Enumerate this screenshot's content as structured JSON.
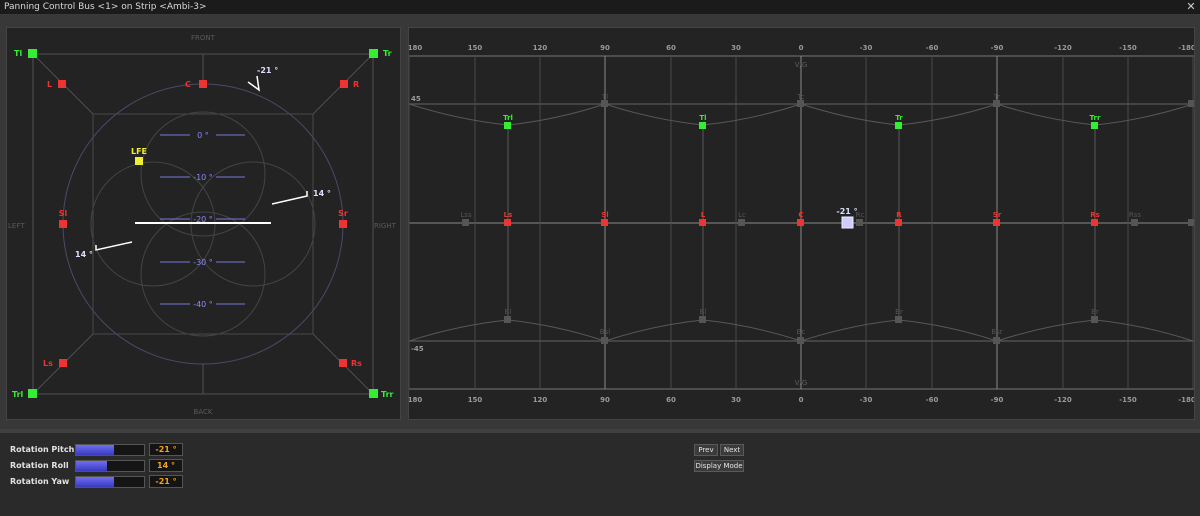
{
  "window": {
    "title": "Panning Control Bus <1> on Strip <Ambi-3>",
    "close_symbol": "✕"
  },
  "colors": {
    "green": "#33ee33",
    "red": "#ee3333",
    "yellow": "#eeee33",
    "blue_label": "#8888ff",
    "rotation_handle": "#ccccff"
  },
  "left_view": {
    "labels": {
      "front": "FRONT",
      "back": "BACK",
      "left": "LEFT",
      "right": "RIGHT"
    },
    "speakers": [
      {
        "name": "Tl",
        "color": "green"
      },
      {
        "name": "Tr",
        "color": "green"
      },
      {
        "name": "L",
        "color": "red"
      },
      {
        "name": "C",
        "color": "red"
      },
      {
        "name": "R",
        "color": "red"
      },
      {
        "name": "LFE",
        "color": "yellow"
      },
      {
        "name": "Sl",
        "color": "red"
      },
      {
        "name": "Sr",
        "color": "red"
      },
      {
        "name": "Ls",
        "color": "red"
      },
      {
        "name": "Rs",
        "color": "red"
      },
      {
        "name": "Trl",
        "color": "green"
      },
      {
        "name": "Trr",
        "color": "green"
      }
    ],
    "elevation_labels": [
      "0 °",
      "-10 °",
      "-20 °",
      "-30 °",
      "-40 °"
    ],
    "pitch_label": "-21 °",
    "roll_label_right": "14 °",
    "roll_label_left": "14 °"
  },
  "right_view": {
    "azimuth_ticks": [
      "180",
      "150",
      "120",
      "90",
      "60",
      "30",
      "0",
      "-30",
      "-60",
      "-90",
      "-120",
      "-150",
      "-180"
    ],
    "elevation_labels": {
      "top": "45",
      "bottom": "-45"
    },
    "pole_labels": {
      "top": "V/G",
      "bottom": "V/G"
    },
    "top_speakers": [
      "Trl",
      "Tl",
      "Tr",
      "Trr"
    ],
    "mid_speakers": [
      "Ls",
      "Sl",
      "L",
      "C",
      "R",
      "Sr",
      "Rs"
    ],
    "dim_top": [
      "Tl",
      "Tc",
      "Tr"
    ],
    "dim_mid": [
      "Lss",
      "Lc",
      "Rc",
      "Rss"
    ],
    "dim_bottom": [
      "Bl",
      "Bc",
      "Br",
      "Bsr",
      "Bsl"
    ],
    "marker_label": "-21 °"
  },
  "controls": {
    "rotation_pitch": {
      "label": "Rotation Pitch",
      "value": "-21 °",
      "fill": 0.56
    },
    "rotation_roll": {
      "label": "Rotation Roll",
      "value": "14 °",
      "fill": 0.46
    },
    "rotation_yaw": {
      "label": "Rotation Yaw",
      "value": "-21 °",
      "fill": 0.56
    },
    "prev_label": "Prev",
    "next_label": "Next",
    "display_mode_label": "Display Mode"
  }
}
